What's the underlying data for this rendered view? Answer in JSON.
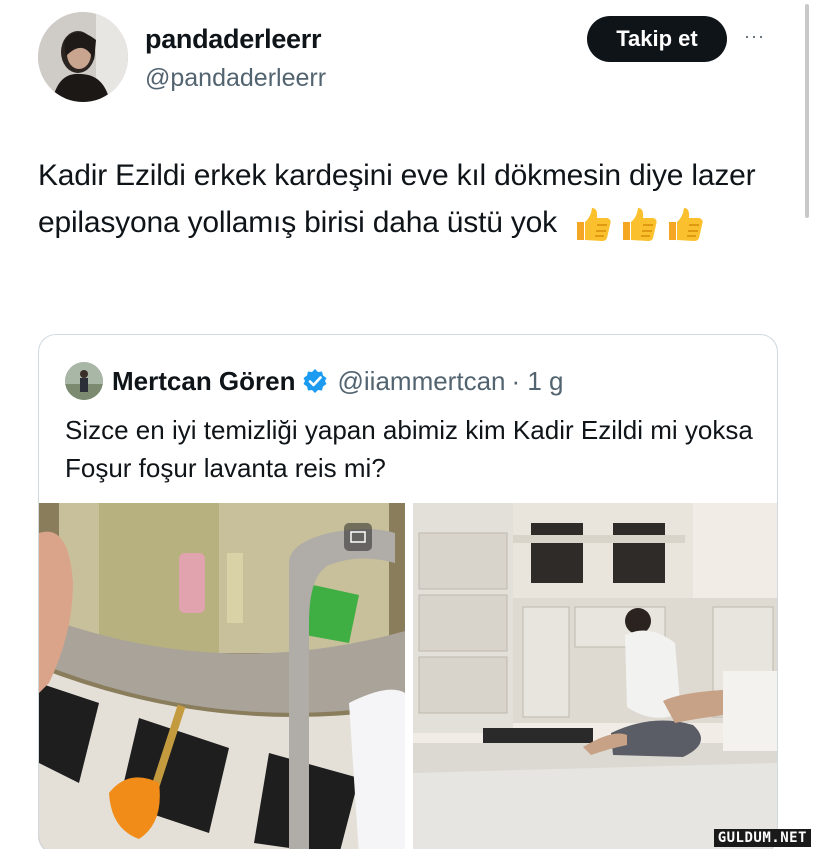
{
  "author": {
    "name": "pandaderleerr",
    "handle": "@pandaderleerr",
    "follow_label": "Takip et",
    "more_label": "···"
  },
  "tweet": {
    "text": "Kadir Ezildi erkek kardeşini eve kıl dökmesin diye lazer epilasyona yollamış birisi daha üstü yok",
    "emoji": [
      "thumbs-up",
      "thumbs-up",
      "thumbs-up"
    ]
  },
  "quoted_tweet": {
    "name": "Mertcan Gören",
    "handle": "@iiammertcan",
    "time": "· 1 g",
    "text": "Sizce en iyi temizliği yapan abimiz kim Kadir Ezildi mi yoksa Foşur foşur lavanta reis mi?",
    "media": [
      "shower-cleaning-photo",
      "kitchen-floor-cleaning-photo"
    ],
    "verified_color": "#1d9bf0"
  },
  "watermark": "GULDUM.NET",
  "colors": {
    "text": "#0f1419",
    "secondary": "#536471",
    "border": "#cfd9de",
    "follow_bg": "#0f1419"
  }
}
